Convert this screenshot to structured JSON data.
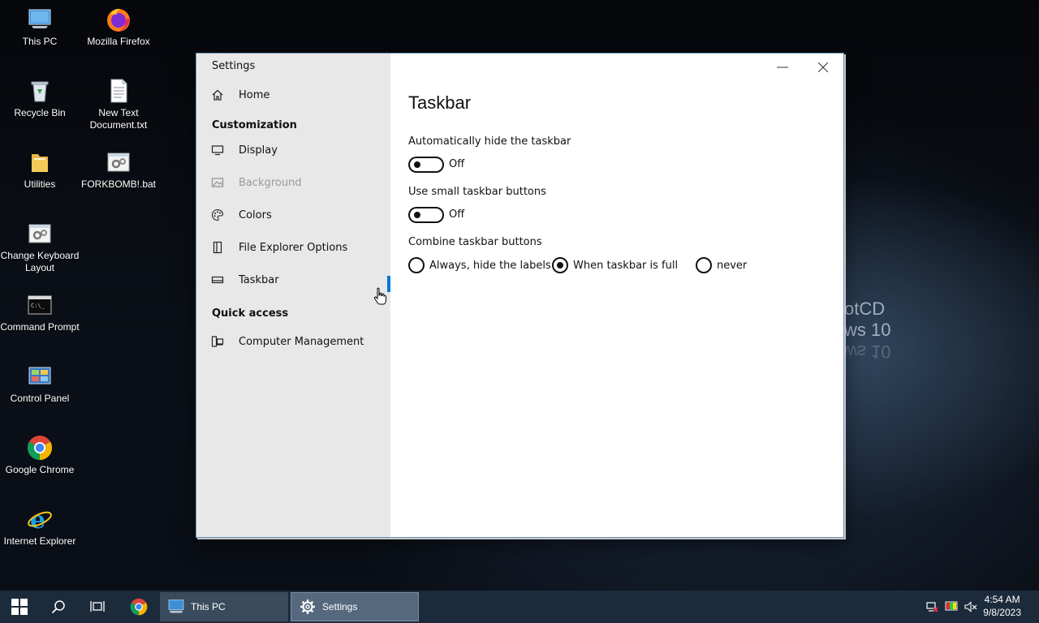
{
  "desktop": {
    "icons": [
      {
        "label": "This PC"
      },
      {
        "label": "Mozilla Firefox"
      },
      {
        "label": "Recycle Bin"
      },
      {
        "label": "New Text Document.txt"
      },
      {
        "label": "Utilities"
      },
      {
        "label": "FORKBOMB!.bat"
      },
      {
        "label": "Change Keyboard Layout"
      },
      {
        "label": "Command Prompt"
      },
      {
        "label": "Control Panel"
      },
      {
        "label": "Google Chrome"
      },
      {
        "label": "Internet Explorer"
      }
    ],
    "wallpaper_text_1": "otCD",
    "wallpaper_text_2": "ws 10"
  },
  "settings": {
    "app_title": "Settings",
    "nav": {
      "home": "Home",
      "section_customization": "Customization",
      "display": "Display",
      "background": "Background",
      "colors": "Colors",
      "file_explorer": "File Explorer Options",
      "taskbar": "Taskbar",
      "section_quick": "Quick access",
      "computer_mgmt": "Computer Management"
    },
    "page": {
      "title": "Taskbar",
      "auto_hide_label": "Automatically hide the taskbar",
      "auto_hide_state": "Off",
      "small_buttons_label": "Use small taskbar buttons",
      "small_buttons_state": "Off",
      "combine_label": "Combine taskbar buttons",
      "combine_options": [
        "Always, hide the labels",
        "When taskbar is full",
        "never"
      ],
      "combine_selected": "When taskbar is full"
    },
    "selected_nav": "Taskbar",
    "accent_color": "#0078d7"
  },
  "taskbar": {
    "apps": [
      {
        "label": "This PC"
      },
      {
        "label": "Settings"
      }
    ],
    "time": "4:54 AM",
    "date": "9/8/2023"
  }
}
